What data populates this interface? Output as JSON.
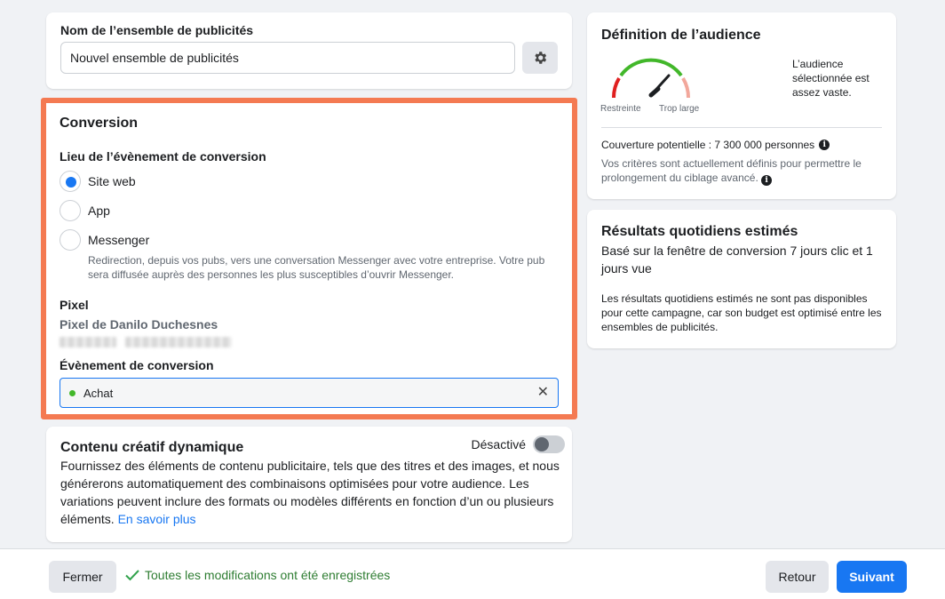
{
  "name_card": {
    "title": "Nom de l’ensemble de publicités",
    "value": "Nouvel ensemble de publicités"
  },
  "conversion": {
    "title": "Conversion",
    "location_title": "Lieu de l’évènement de conversion",
    "options": [
      {
        "label": "Site web",
        "selected": true
      },
      {
        "label": "App",
        "selected": false
      },
      {
        "label": "Messenger",
        "selected": false
      }
    ],
    "messenger_helper": "Redirection, depuis vos pubs, vers une conversation Messenger avec votre entreprise. Votre pub sera diffusée auprès des personnes les plus susceptibles d’ouvrir Messenger.",
    "pixel_title": "Pixel",
    "pixel_name": "Pixel de Danilo Duchesnes",
    "event_title": "Évènement de conversion",
    "event_value": "Achat",
    "event_clear": "✕"
  },
  "dynamic": {
    "title": "Contenu créatif dynamique",
    "toggle_label": "Désactivé",
    "toggle_on": false,
    "description": "Fournissez des éléments de contenu publicitaire, tels que des titres et des images, et nous générerons automatiquement des combinaisons optimisées pour votre audience. Les variations peuvent inclure des formats ou modèles différents en fonction d’un ou plusieurs éléments.",
    "learn_more": "En savoir plus"
  },
  "audience": {
    "title": "Définition de l’audience",
    "gauge_left": "Restreinte",
    "gauge_right": "Trop large",
    "message": "L’audience sélectionnée est assez vaste.",
    "reach": "Couverture potentielle : 7 300 000 personnes",
    "note": "Vos critères sont actuellement définis pour permettre le prolongement du ciblage avancé."
  },
  "results": {
    "title": "Résultats quotidiens estimés",
    "subtitle": "Basé sur la fenêtre de conversion 7 jours clic et 1 jours vue",
    "note": "Les résultats quotidiens estimés ne sont pas disponibles pour cette campagne, car son budget est optimisé entre les ensembles de publicités."
  },
  "footer": {
    "close_label": "Fermer",
    "saved_message": "Toutes les modifications ont été enregistrées",
    "back_label": "Retour",
    "next_label": "Suivant"
  },
  "colors": {
    "accent": "#1877f2",
    "highlight": "#f47a52",
    "success": "#31a24c"
  }
}
